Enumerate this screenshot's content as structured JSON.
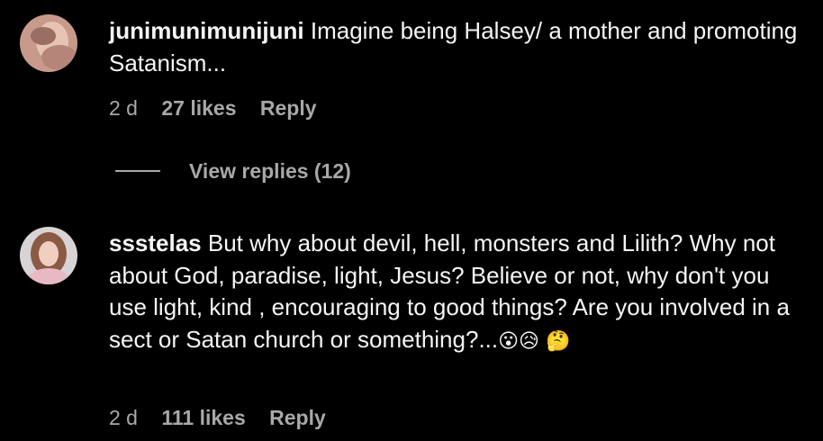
{
  "comments": [
    {
      "username": "junimunimunijuni",
      "text": " Imagine being Halsey/ a mother and promoting Satanism...",
      "time": "2 d",
      "likes": "27 likes",
      "reply": "Reply",
      "view_replies": "View replies (12)",
      "avatar_icon": "user-avatar-1"
    },
    {
      "username": "ssstelas",
      "text": " But why about devil, hell, monsters and Lilith? Why not about God, paradise, light, Jesus? Believe or not, why don't you use light, kind , encouraging to good things? Are you involved in a sect or Satan church or something?...",
      "emoji": "😮😥 🤔",
      "time": "2 d",
      "likes": "111 likes",
      "reply": "Reply",
      "avatar_icon": "user-avatar-2"
    }
  ]
}
